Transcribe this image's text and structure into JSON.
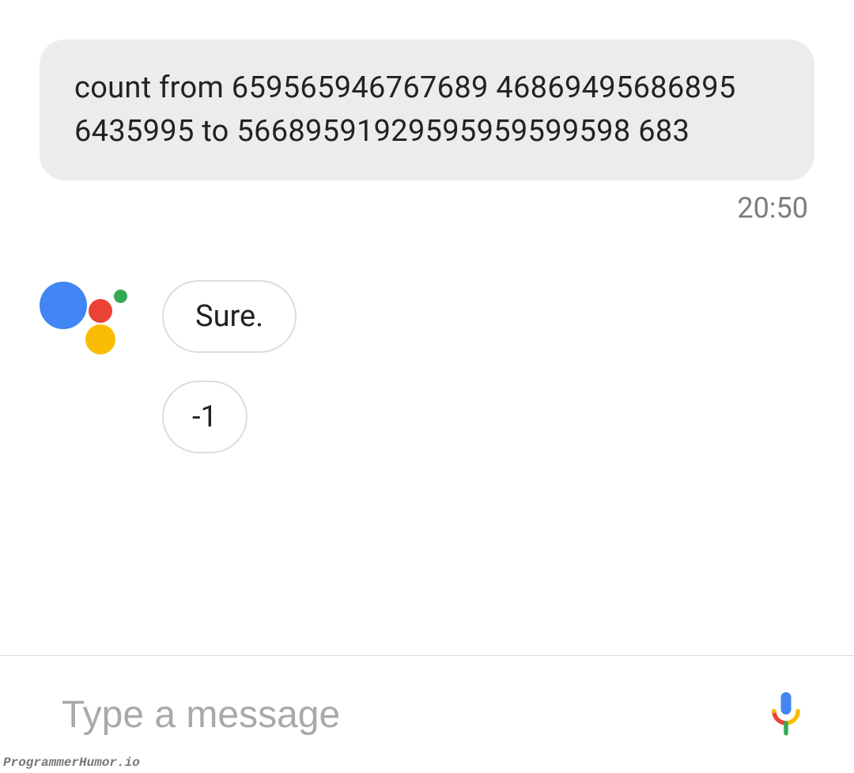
{
  "conversation": {
    "user_message": "count from 659565946767689 46869495686895 6435995 to 5668959192959595 9599598683",
    "user_message_display": "count from 659565946767689 46869495686895 6435995 to 56689591929595959599598 683",
    "user_text": "count from 659565946767689 46869495686895 6435995 to 5668959192959595959959 8683",
    "timestamp": "20:50",
    "assistant_replies": [
      "Sure.",
      "-1"
    ]
  },
  "user_msg": "count from 659565946767689 46869495686895 6435995 to 56689591929595959599598 683",
  "input": {
    "placeholder": "Type a message"
  },
  "watermark": "ProgrammerHumor.io",
  "colors": {
    "bubble_bg": "#ebecee",
    "google_blue": "#4285F4",
    "google_red": "#EA4335",
    "google_yellow": "#FBBC05",
    "google_green": "#34A853"
  }
}
